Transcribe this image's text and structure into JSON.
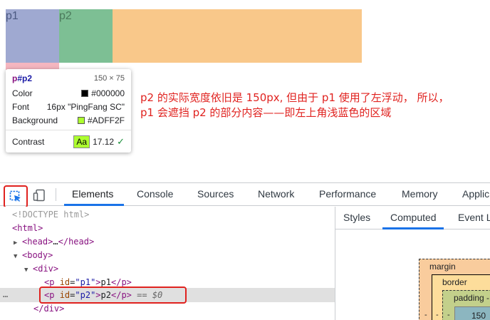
{
  "page": {
    "p1_text": "p1",
    "p2_text": "p2"
  },
  "tooltip": {
    "tag": "p",
    "id": "#p2",
    "size": "150 × 75",
    "rows": [
      {
        "label": "Color",
        "value": "#000000",
        "swatch": "#000000"
      },
      {
        "label": "Font",
        "value": "16px \"PingFang SC\""
      },
      {
        "label": "Background",
        "value": "#ADFF2F",
        "swatch": "#adff2f"
      }
    ],
    "contrast_label": "Contrast",
    "contrast_badge": "Aa",
    "contrast_value": "17.12",
    "check_icon": "check-icon"
  },
  "note": {
    "line1": "p2 的实际宽度依旧是 150px, 但由于 p1 使用了左浮动， 所以，",
    "line2": "p1 会遮挡 p2 的部分内容——即左上角浅蓝色的区域"
  },
  "devtools": {
    "toolbar_icons": [
      "inspect-element-icon",
      "device-toolbar-icon"
    ],
    "tabs": [
      "Elements",
      "Console",
      "Sources",
      "Network",
      "Performance",
      "Memory",
      "Applic"
    ],
    "active_tab": "Elements",
    "side_tabs": [
      "Styles",
      "Computed",
      "Event L"
    ],
    "active_side_tab": "Computed",
    "box_model": {
      "margin": "margin",
      "border": "border",
      "padding": "padding -",
      "content": "150",
      "dash": "-"
    },
    "dom": {
      "doctype": "<!DOCTYPE html>",
      "html_open": "<html>",
      "head": "head",
      "head_ellipsis": "…",
      "body": "body",
      "div": "div",
      "p_tag": "p",
      "id_attr": "id",
      "p1_id": "\"p1\"",
      "p1_text": "p1",
      "p2_id": "\"p2\"",
      "p2_text": "p2",
      "eq_marker": "== ",
      "eq_var": "$0",
      "div_close": "</div>",
      "dots": "…"
    }
  },
  "colors": {
    "accent": "#1a73e8",
    "annotation": "#e0221f",
    "p1_bg": "#9fa9d1",
    "p2_bg": "#7dbf94",
    "div_overlay": "#f9c88a"
  }
}
